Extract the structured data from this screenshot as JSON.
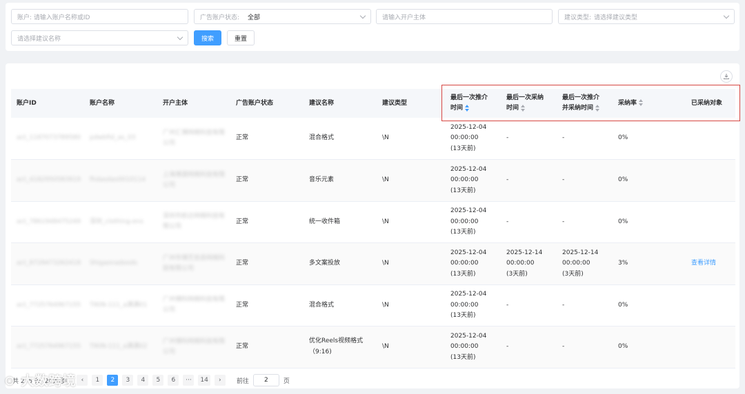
{
  "filters": {
    "account_placeholder": "账户: 请输入账户名称或ID",
    "status_label": "广告账户状态:",
    "status_value": "全部",
    "entity_placeholder": "请输入开户主体",
    "suggest_type_label": "建议类型:",
    "suggest_type_placeholder": "请选择建议类型",
    "suggest_name_placeholder": "请选择建议名称",
    "search_label": "搜索",
    "reset_label": "重置"
  },
  "table": {
    "headers": {
      "account_id": "账户ID",
      "account_name": "账户名称",
      "entity": "开户主体",
      "status": "广告账户状态",
      "suggest_name": "建议名称",
      "suggest_type": "建议类型",
      "last_push_1": "最后一次推介",
      "last_push_2": "时间",
      "last_adopt_1": "最后一次采纳",
      "last_adopt_2": "时间",
      "last_push_adopt_1": "最后一次推介",
      "last_push_adopt_2": "并采纳时间",
      "adopt_rate": "采纳率",
      "adopted_objects": "已采纳对象"
    },
    "rows": [
      {
        "account_id": "act_1187073789580",
        "account_name": "pdwbfid_as_03",
        "entity": "广州汇博网络科技有限公司",
        "status": "正常",
        "suggest_name": "混合格式",
        "suggest_type": "\\N",
        "push_date": "2025-12-04",
        "push_time": "00:00:00",
        "push_ago": "(13天前)",
        "adopt_date": "-",
        "adopt_time": "",
        "adopt_ago": "",
        "pa_date": "-",
        "pa_time": "",
        "pa_ago": "",
        "rate": "0%",
        "objects": ""
      },
      {
        "account_id": "act_4182950583919",
        "account_name": "fhdasdas0010114",
        "entity": "上海博源网络科技有限公司",
        "status": "正常",
        "suggest_name": "音乐元素",
        "suggest_type": "\\N",
        "push_date": "2025-12-04",
        "push_time": "00:00:00",
        "push_ago": "(13天前)",
        "adopt_date": "-",
        "adopt_time": "",
        "adopt_ago": "",
        "pa_date": "-",
        "pa_time": "",
        "pa_ago": "",
        "rate": "0%",
        "objects": ""
      },
      {
        "account_id": "act_7861948475249",
        "account_name": "深圳_clothing-ens",
        "entity": "深圳市航达网络科技有限公司",
        "status": "正常",
        "suggest_name": "统一收件箱",
        "suggest_type": "\\N",
        "push_date": "2025-12-04",
        "push_time": "00:00:00",
        "push_ago": "(13天前)",
        "adopt_date": "-",
        "adopt_time": "",
        "adopt_ago": "",
        "pa_date": "-",
        "pa_time": "",
        "pa_ago": "",
        "rate": "0%",
        "objects": ""
      },
      {
        "account_id": "act_8729473262418",
        "account_name": "Shigaonadoods",
        "entity": "广州市博艺信息网络科技有限公司",
        "status": "正常",
        "suggest_name": "多文案投放",
        "suggest_type": "\\N",
        "push_date": "2025-12-04",
        "push_time": "00:00:00",
        "push_ago": "(13天前)",
        "adopt_date": "2025-12-14",
        "adopt_time": "00:00:00",
        "adopt_ago": "(3天前)",
        "pa_date": "2025-12-14",
        "pa_time": "00:00:00",
        "pa_ago": "(3天前)",
        "rate": "3%",
        "objects": "查看详情"
      },
      {
        "account_id": "act_7725764967155",
        "account_name": "TIKIN-111_a满满01",
        "entity": "广州博科网络科技有限公司",
        "status": "正常",
        "suggest_name": "混合格式",
        "suggest_type": "\\N",
        "push_date": "2025-12-04",
        "push_time": "00:00:00",
        "push_ago": "(13天前)",
        "adopt_date": "-",
        "adopt_time": "",
        "adopt_ago": "",
        "pa_date": "-",
        "pa_time": "",
        "pa_ago": "",
        "rate": "0%",
        "objects": ""
      },
      {
        "account_id": "act_7725764967155",
        "account_name": "TIKIN-111_a满满02",
        "entity": "广州博科网络科技有限公司",
        "status": "正常",
        "suggest_name": "优化Reels视频格式（9:16)",
        "suggest_type": "\\N",
        "push_date": "2025-12-04",
        "push_time": "00:00:00",
        "push_ago": "(13天前)",
        "adopt_date": "-",
        "adopt_time": "",
        "adopt_ago": "",
        "pa_date": "-",
        "pa_time": "",
        "pa_ago": "",
        "rate": "0%",
        "objects": ""
      }
    ]
  },
  "pagination": {
    "total": "共 275 条",
    "page_size": "20条/页",
    "pages": [
      "1",
      "2",
      "3",
      "4",
      "5",
      "6"
    ],
    "current": "2",
    "ellipsis": "···",
    "last": "14",
    "goto_label": "前往",
    "goto_value": "2",
    "goto_suffix": "页"
  },
  "watermark": "大数跨境",
  "colors": {
    "primary": "#409eff",
    "highlight": "#d64541"
  }
}
